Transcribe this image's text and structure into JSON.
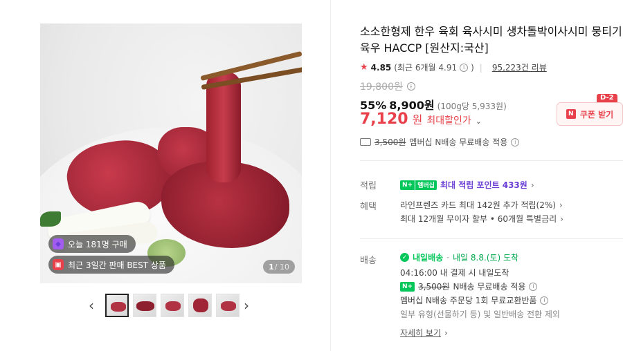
{
  "gallery": {
    "badge_buyers": "오늘 181명 구매",
    "badge_best": "최근 3일간 판매 BEST 상품",
    "counter_current": "1",
    "counter_total": "/ 10",
    "prev_icon": "chevron-left-icon",
    "next_icon": "chevron-right-icon",
    "thumbnail_count": 5
  },
  "product": {
    "title": "소소한형제 한우 육회 육사시미 생차돌박이사시미 뭉티기 육우 HACCP [원산지:국산]",
    "rating": "4.85",
    "rating_recent": "(최근 6개월 4.91",
    "rating_recent_close": ")",
    "review_count": "95,223건 리뷰",
    "original_price": "19,800원",
    "discount_rate": "55%",
    "sale_price": "8,900원",
    "unit_price": "(100g당 5,933원)",
    "max_discount_price": "7,120",
    "max_discount_won": "원",
    "max_discount_label": "최대할인가",
    "coupon_label": "쿠폰 받기",
    "coupon_deadline": "D-2",
    "shipping_fee_strike": "3,500원",
    "shipping_note": "멤버십 N배송 무료배송 적용"
  },
  "points": {
    "label": "적립",
    "membership": "멤버십",
    "max_points": "최대 적립 포인트 433원"
  },
  "benefits": {
    "label": "혜택",
    "line1": "라인프렌즈 카드 최대 142원 추가 적립(2%)",
    "line2": "최대 12개월 무이자 할부 • 60개월 특별금리"
  },
  "delivery": {
    "label": "배송",
    "brand": "내일배송",
    "date": "내일 8.8.(토) 도착",
    "cutoff": "04:16:00  내 결제 시 내일도착",
    "fee_strike": "3,500원",
    "fee_note": "N배송 무료배송 적용",
    "return_note": "멤버십 N배송 주문당 1회 무료교환반품",
    "exclusion": "일부 유형(선물하기 등) 및 일반배송 전환 제외",
    "details_link": "자세히 보기"
  },
  "colors": {
    "accent_red": "#e8414b",
    "naver_green": "#03c75a",
    "purple": "#6b3fd6"
  }
}
